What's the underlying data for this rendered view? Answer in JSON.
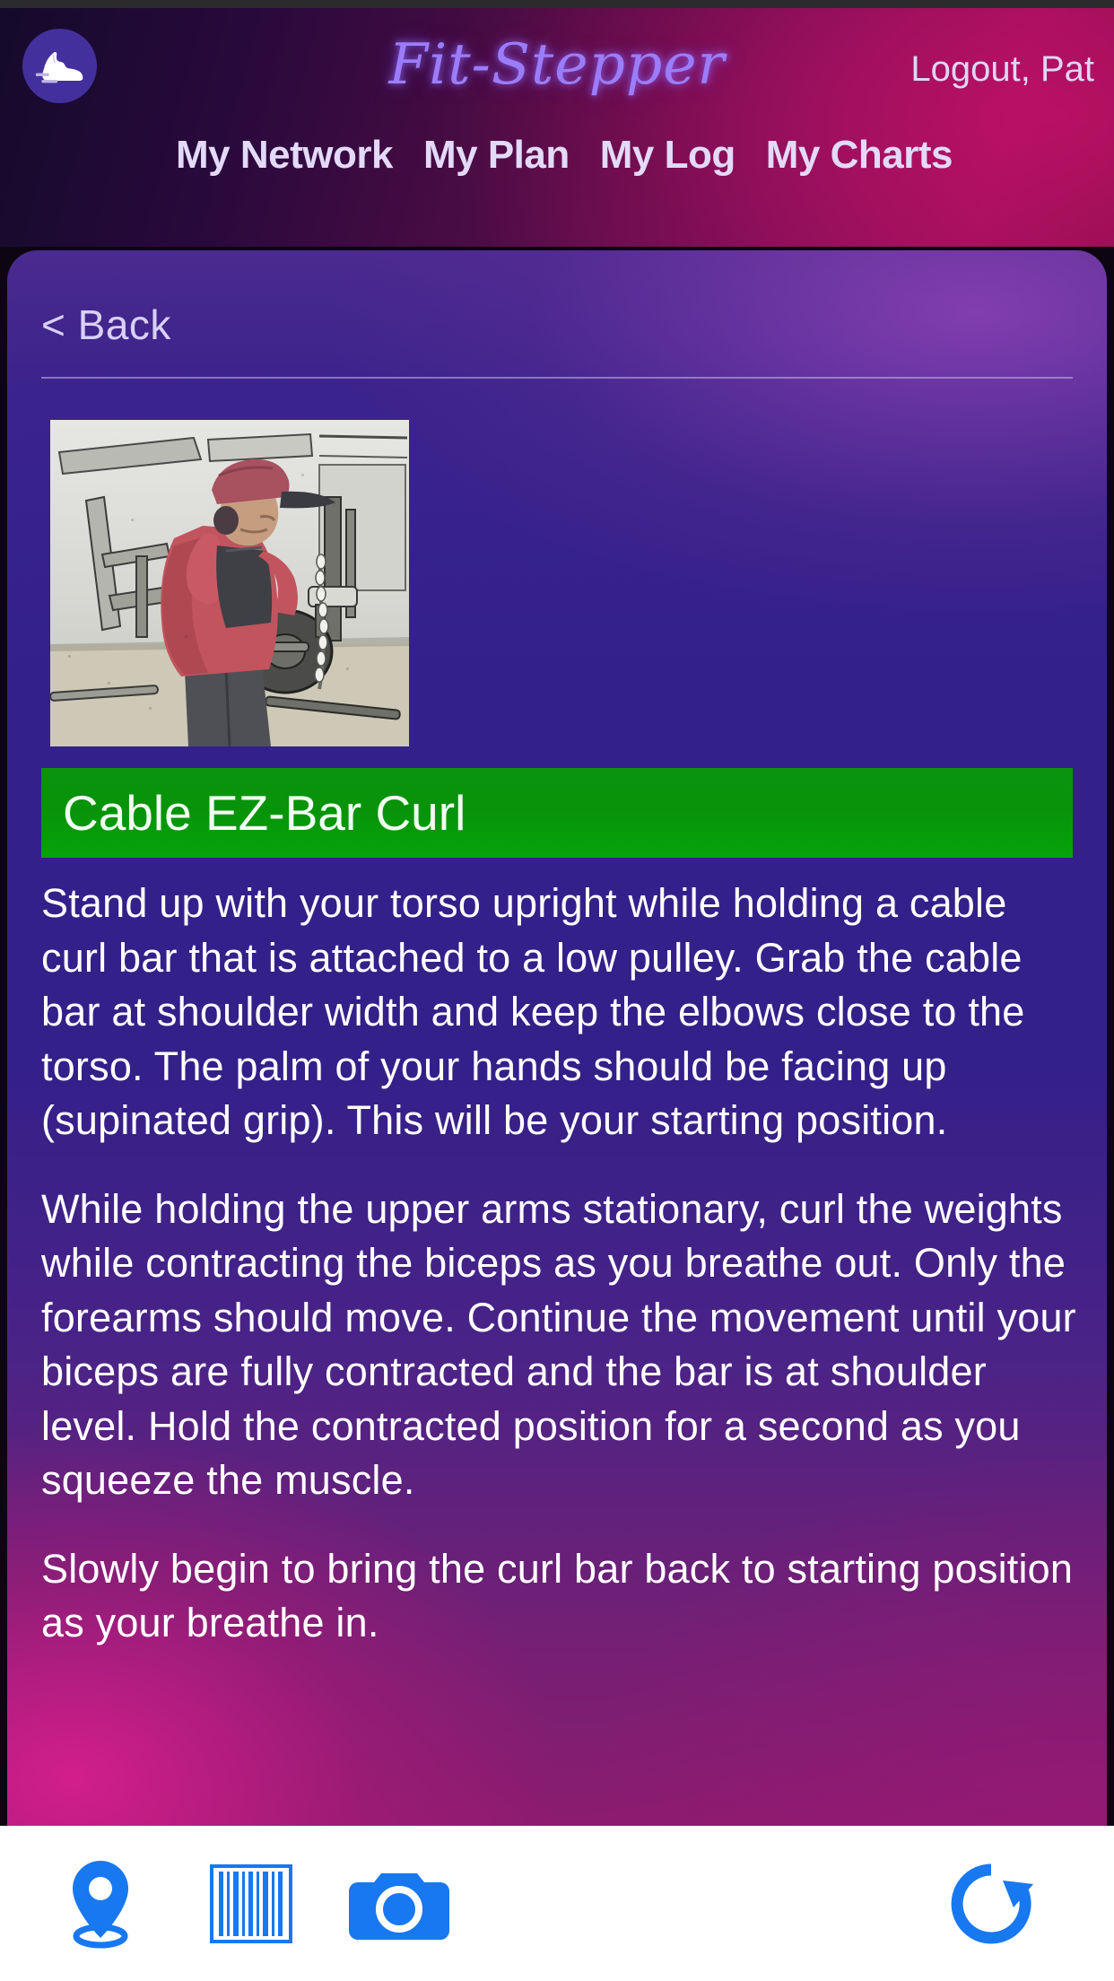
{
  "app": {
    "title": "Fit-Stepper",
    "logout_label": "Logout, Pat",
    "logo_icon": "running-shoe-icon"
  },
  "nav": {
    "items": [
      {
        "label": "My Network"
      },
      {
        "label": "My Plan"
      },
      {
        "label": "My Log"
      },
      {
        "label": "My Charts"
      }
    ]
  },
  "content": {
    "back_label": "< Back",
    "exercise_image_alt": "person performing cable ez-bar curl in a gym",
    "exercise_title": "Cable EZ-Bar Curl",
    "paragraphs": [
      "Stand up with your torso upright while holding a cable curl bar that is attached to a low pulley. Grab the cable bar at shoulder width and keep the elbows close to the torso. The palm of your hands should be facing up (supinated grip). This will be your starting position.",
      "While holding the upper arms stationary, curl the weights while contracting the biceps as you breathe out. Only the forearms should move. Continue the movement until your biceps are fully contracted and the bar is at shoulder level. Hold the contracted position for a second as you squeeze the muscle.",
      "Slowly begin to bring the curl bar back to starting position as your breathe in."
    ]
  },
  "toolbar": {
    "buttons": [
      {
        "name": "location-pin-icon"
      },
      {
        "name": "barcode-icon"
      },
      {
        "name": "camera-icon"
      },
      {
        "name": "refresh-icon"
      }
    ]
  },
  "colors": {
    "header_left": "#140a2b",
    "header_right": "#a5125f",
    "card_top": "#3a238c",
    "card_bottom": "#8c1c6e",
    "title_bar_green": "#079309",
    "toolbar_icon_blue": "#1878f0",
    "accent_lavender": "#9b7dfb",
    "text_white": "#ffffff"
  }
}
